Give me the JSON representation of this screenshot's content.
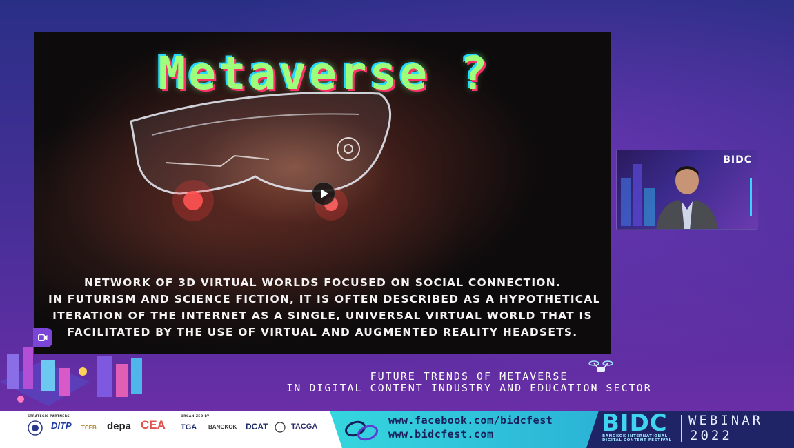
{
  "slide": {
    "title": "Metaverse ?",
    "caption_lines": [
      "NETWORK OF 3D VIRTUAL WORLDS FOCUSED ON SOCIAL CONNECTION.",
      "IN FUTURISM AND SCIENCE FICTION, IT IS OFTEN DESCRIBED AS A HYPOTHETICAL",
      "ITERATION OF THE INTERNET AS A SINGLE, UNIVERSAL VIRTUAL WORLD THAT IS",
      "FACILITATED BY THE USE OF VIRTUAL AND AUGMENTED REALITY HEADSETS."
    ],
    "play_icon": "play-icon"
  },
  "speaker": {
    "logo": "BIDC"
  },
  "camera_icon": "video-camera-icon",
  "topic": {
    "line1": "FUTURE TRENDS OF METAVERSE",
    "line2": "IN DIGITAL CONTENT INDUSTRY AND EDUCATION SECTOR"
  },
  "footer": {
    "strategic_label": "STRATEGIC PARTNERS",
    "organized_label": "ORGANIZED BY",
    "partners": [
      "DITP",
      "TCEB",
      "depa",
      "CEA"
    ],
    "organizers": [
      "TGA",
      "BANGKOK",
      "DCAT",
      "TACGA"
    ],
    "facebook": "www.facebook.com/bidcfest",
    "website": "www.bidcfest.com",
    "brand": "BIDC",
    "brand_sub_1": "BANGKOK INTERNATIONAL",
    "brand_sub_2": "DIGITAL CONTENT FESTIVAL",
    "event_type": "WEBINAR",
    "year": "2022"
  },
  "colors": {
    "title_green": "#9dff7a",
    "accent_teal": "#35d6df",
    "navy": "#1f2466",
    "purple": "#4a2e98"
  }
}
